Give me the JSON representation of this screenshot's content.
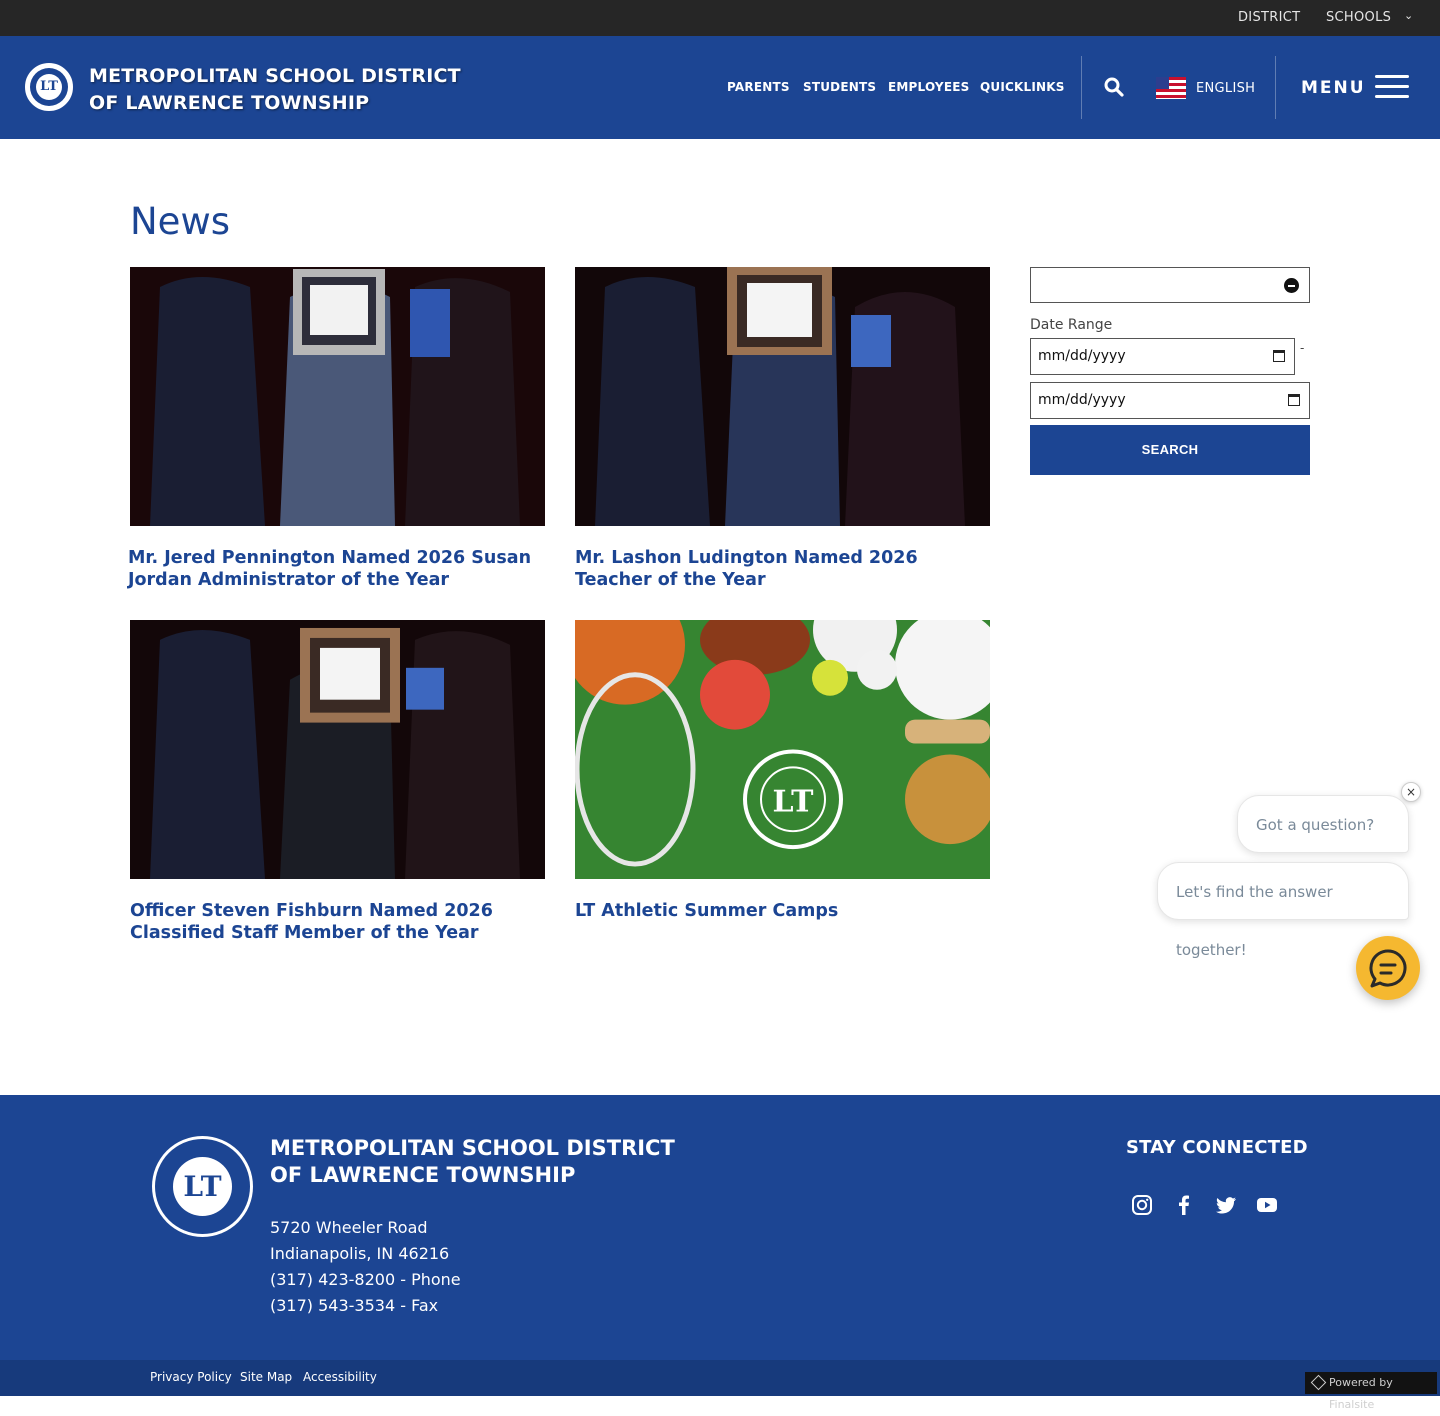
{
  "utility": {
    "district": "DISTRICT",
    "schools": "SCHOOLS"
  },
  "header": {
    "title_line1": "METROPOLITAN SCHOOL DISTRICT",
    "title_line2": "OF LAWRENCE TOWNSHIP",
    "nav": [
      "PARENTS",
      "STUDENTS",
      "EMPLOYEES",
      "QUICKLINKS"
    ],
    "language": "ENGLISH",
    "menu_label": "MENU"
  },
  "main": {
    "page_title": "News",
    "articles": [
      {
        "title": "Mr. Jered Pennington Named 2026 Susan Jordan Administrator of the Year"
      },
      {
        "title": "Mr. Lashon Ludington Named 2026 Teacher of the Year"
      },
      {
        "title": "Officer Steven Fishburn Named 2026 Classified Staff Member of the Year"
      },
      {
        "title": "LT Athletic Summer Camps"
      }
    ]
  },
  "filter": {
    "date_range_label": "Date Range",
    "start_placeholder": "mm/dd/yyyy",
    "end_placeholder": "mm/dd/yyyy",
    "separator": "-",
    "search_label": "SEARCH"
  },
  "chat": {
    "close": "×",
    "bubble_1": "Got a question? 👋",
    "bubble_2": "Let's find the answer together!"
  },
  "footer": {
    "title_line1": "METROPOLITAN SCHOOL DISTRICT",
    "title_line2": "OF LAWRENCE TOWNSHIP",
    "address_line1": "5720 Wheeler Road",
    "address_line2": "Indianapolis, IN  46216",
    "phone": "(317) 423-8200 - Phone",
    "fax": "(317) 543-3534 - Fax",
    "stay_connected": "STAY CONNECTED",
    "social_icons": [
      "instagram-icon",
      "facebook-icon",
      "twitter-icon",
      "youtube-icon"
    ],
    "links": [
      "Privacy Policy",
      "Site Map",
      "Accessibility"
    ],
    "powered_by": "Powered by Finalsite"
  },
  "colors": {
    "brand_blue": "#1c4593",
    "chat_yellow": "#f5b830",
    "utility_bar": "#262626"
  }
}
